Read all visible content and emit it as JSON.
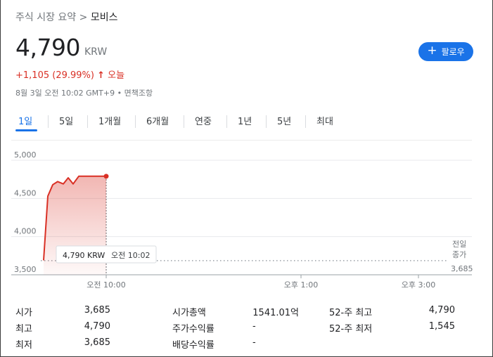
{
  "breadcrumb": {
    "parent": "주식 시장 요약",
    "separator": ">",
    "current": "모비스"
  },
  "quote": {
    "price": "4,790",
    "currency": "KRW",
    "change": "+1,105 (29.99%)",
    "change_arrow": "↑",
    "change_period": "오늘",
    "timestamp": "8월 3일 오전 10:02 GMT+9 • 면책조항"
  },
  "follow_button": {
    "icon": "plus-icon",
    "label": "팔로우",
    "color": "#1a73e8"
  },
  "tabs": [
    {
      "label": "1일",
      "active": true
    },
    {
      "label": "5일"
    },
    {
      "label": "1개월"
    },
    {
      "label": "6개월"
    },
    {
      "label": "연중"
    },
    {
      "label": "1년"
    },
    {
      "label": "5년"
    },
    {
      "label": "최대"
    }
  ],
  "chart_data": {
    "type": "area",
    "y_ticks": [
      "5,000",
      "4,500",
      "4,000",
      "3,500"
    ],
    "ylim": [
      3500,
      5200
    ],
    "x_ticks": [
      "오전 10:00",
      "오후 1:00",
      "오후 3:00"
    ],
    "points": [
      3690,
      4530,
      4680,
      4720,
      4690,
      4770,
      4690,
      4790,
      4790,
      4790,
      4790,
      4790,
      4790,
      4790
    ],
    "previous_close": {
      "label_line1": "전일",
      "label_line2": "종가",
      "value": "3,685",
      "raw": 3685
    },
    "tooltip": {
      "price": "4,790 KRW",
      "time": "오전 10:02"
    },
    "line_color": "#d93025"
  },
  "stats": {
    "col1": [
      {
        "label": "시가",
        "value": "3,685"
      },
      {
        "label": "최고",
        "value": "4,790"
      },
      {
        "label": "최저",
        "value": "3,685"
      }
    ],
    "col2": [
      {
        "label": "시가총액",
        "value": "1541.01억"
      },
      {
        "label": "주가수익률",
        "value": "-"
      },
      {
        "label": "배당수익률",
        "value": "-"
      }
    ],
    "col3": [
      {
        "label": "52-주 최고",
        "value": "4,790"
      },
      {
        "label": "52-주 최저",
        "value": "1,545"
      }
    ]
  }
}
